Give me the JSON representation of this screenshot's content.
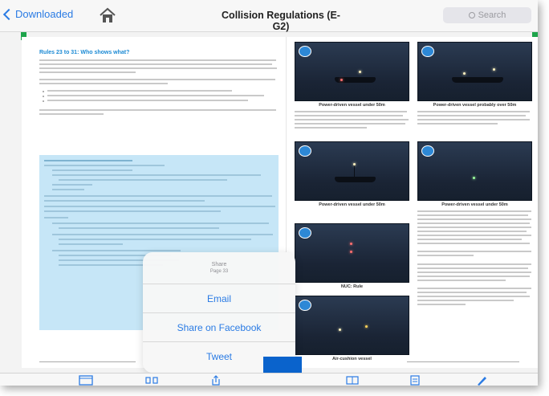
{
  "navbar": {
    "back_label": "Downloaded",
    "title": "Collision Regulations (E-G2)",
    "search_placeholder": "Search"
  },
  "left_page": {
    "rule_heading": "Rules 23 to 31: Who shows what?"
  },
  "right_page": {
    "captions": [
      "Power-driven vessel under 50m",
      "Power-driven vessel probably over 50m",
      "Power-driven vessel under 50m",
      "Power-driven vessel under 50m",
      "NUC: Rule",
      "Air-cushion vessel"
    ]
  },
  "share_popover": {
    "title": "Share",
    "subtitle": "Page 33",
    "items": [
      "Email",
      "Share on Facebook",
      "Tweet"
    ]
  },
  "colors": {
    "accent": "#2a7be4",
    "highlight_box": "#c6e6f7",
    "bookmark_green": "#1ea54b",
    "overlay_blue": "#0a63cc"
  },
  "toolbar": {
    "icons": [
      "calendar-icon",
      "thumbnails-icon",
      "share-icon",
      "book-icon",
      "notes-icon",
      "pen-icon"
    ]
  }
}
